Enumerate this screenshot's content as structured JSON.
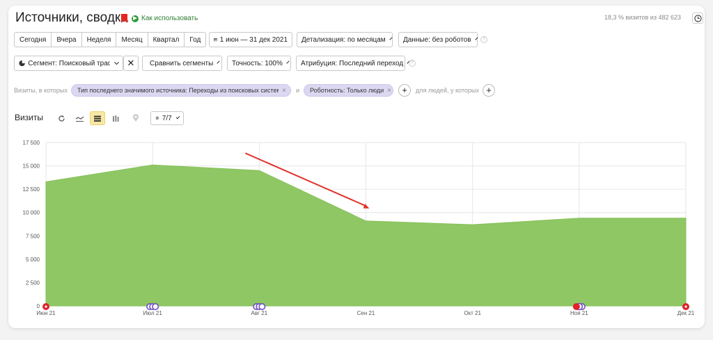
{
  "header": {
    "title": "Источники, сводка",
    "how_to_use": "Как использовать",
    "sample_info": "18,3 % визитов из 482 623"
  },
  "toolbar": {
    "periods": [
      "Сегодня",
      "Вчера",
      "Неделя",
      "Месяц",
      "Квартал",
      "Год"
    ],
    "date_range": "1 июн — 31 дек 2021",
    "detail": "Детализация: по месяцам",
    "data": "Данные: без роботов"
  },
  "segment_bar": {
    "segment": "Сегмент: Поисковый трафик",
    "compare": "Сравнить сегменты",
    "accuracy": "Точность: 100%",
    "attribution": "Атрибуция: Последний переход"
  },
  "filters": {
    "prefix": "Визиты, в которых",
    "chip1": "Тип последнего значимого источника: Переходы из поисковых систем",
    "and": "и",
    "chip2": "Роботность: Только люди",
    "suffix": "для людей, у которых"
  },
  "chart_header": {
    "title": "Визиты",
    "series_count": "7/7"
  },
  "colors": {
    "area_fill": "#8fc764",
    "area_stroke": "#86c05a",
    "chip_bg": "#dcd8f2",
    "arrow": "#e0332b",
    "grid": "#e6e6e6"
  },
  "chart_data": {
    "type": "area",
    "title": "",
    "ylabel": "",
    "ylim": [
      0,
      17500
    ],
    "y_ticks": [
      0,
      2500,
      5000,
      7500,
      10000,
      12500,
      15000,
      17500
    ],
    "y_tick_labels": [
      "0",
      "2 500",
      "5 000",
      "7 500",
      "10 000",
      "12 500",
      "15 000",
      "17 500"
    ],
    "categories": [
      "Июн 21",
      "Июл 21",
      "Авг 21",
      "Сен 21",
      "Окт 21",
      "Ноя 21",
      "Дек 21"
    ],
    "series": [
      {
        "name": "",
        "values": [
          13300,
          15100,
          14500,
          9100,
          8700,
          9400,
          9400
        ]
      }
    ],
    "grid": true,
    "markers": [
      {
        "index": 0,
        "color": "#e0222a",
        "kind": "annotation-red"
      },
      {
        "index": 1,
        "color": "#6f4fc0",
        "kind": "annotation-purple"
      },
      {
        "index": 2,
        "color": "#6f4fc0",
        "kind": "annotation-purple"
      },
      {
        "index": 5,
        "color": "#e0222a",
        "kind": "annotation-red-purple"
      },
      {
        "index": 6,
        "color": "#e0222a",
        "kind": "annotation-red"
      }
    ],
    "trend_arrow": {
      "from_index": 2,
      "to_index": 3
    }
  }
}
